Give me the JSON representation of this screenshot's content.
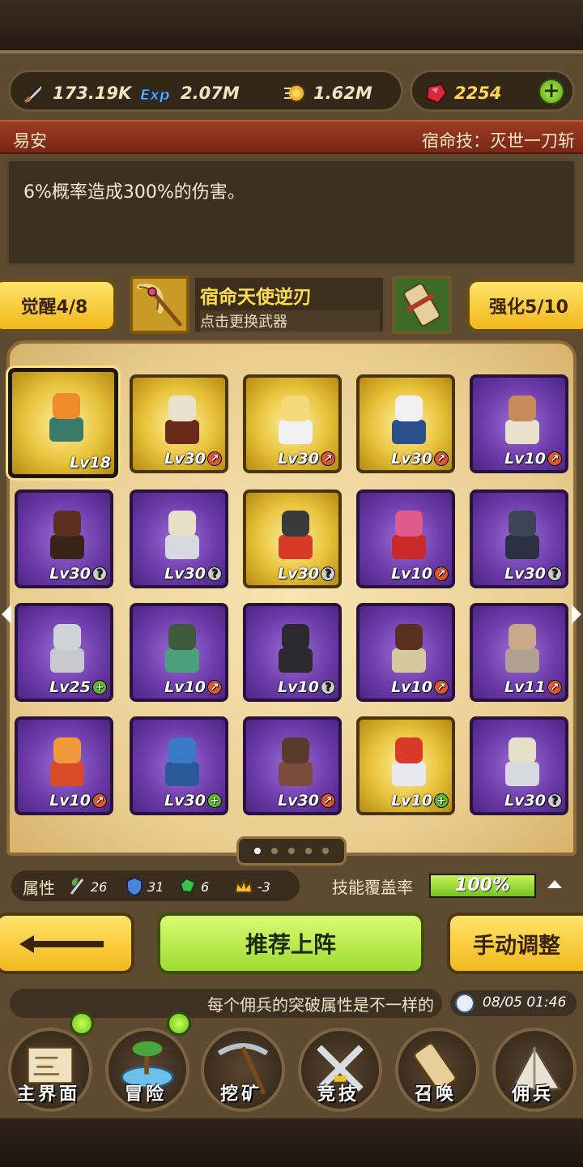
{
  "currencies": {
    "attack": "173.19K",
    "exp": "2.07M",
    "gold": "1.62M",
    "gems": "2254"
  },
  "hero": {
    "name": "易安",
    "fate_skill": "宿命技：灭世一刀斩",
    "skill_desc": "6%概率造成300%的伤害。"
  },
  "awaken": {
    "label": "觉醒4/8"
  },
  "enhance": {
    "label": "强化5/10"
  },
  "weapon": {
    "name": "宿命天使逆刃",
    "hint": "点击更换武器"
  },
  "mercenaries": [
    {
      "level": "Lv18",
      "rarity": "gold",
      "badge": "none",
      "selected": true
    },
    {
      "level": "Lv30",
      "rarity": "gold",
      "badge": "up"
    },
    {
      "level": "Lv30",
      "rarity": "gold",
      "badge": "up"
    },
    {
      "level": "Lv30",
      "rarity": "gold",
      "badge": "up"
    },
    {
      "level": "Lv10",
      "rarity": "purple",
      "badge": "up"
    },
    {
      "level": "Lv30",
      "rarity": "purple",
      "badge": "question"
    },
    {
      "level": "Lv30",
      "rarity": "purple",
      "badge": "question"
    },
    {
      "level": "Lv30",
      "rarity": "gold",
      "badge": "question"
    },
    {
      "level": "Lv10",
      "rarity": "purple",
      "badge": "up"
    },
    {
      "level": "Lv30",
      "rarity": "purple",
      "badge": "question"
    },
    {
      "level": "Lv25",
      "rarity": "purple",
      "badge": "plus"
    },
    {
      "level": "Lv10",
      "rarity": "purple",
      "badge": "up"
    },
    {
      "level": "Lv10",
      "rarity": "purple",
      "badge": "question"
    },
    {
      "level": "Lv10",
      "rarity": "purple",
      "badge": "up"
    },
    {
      "level": "Lv11",
      "rarity": "purple",
      "badge": "up"
    },
    {
      "level": "Lv10",
      "rarity": "purple",
      "badge": "up"
    },
    {
      "level": "Lv30",
      "rarity": "purple",
      "badge": "plus"
    },
    {
      "level": "Lv30",
      "rarity": "purple",
      "badge": "up"
    },
    {
      "level": "Lv10",
      "rarity": "gold",
      "badge": "plus"
    },
    {
      "level": "Lv30",
      "rarity": "purple",
      "badge": "question"
    }
  ],
  "pagination": {
    "pages": 5,
    "current": 1
  },
  "attributes": {
    "label": "属性",
    "nature": "26",
    "defense": "31",
    "gem": "6",
    "crown": "-3"
  },
  "skill_coverage": {
    "label": "技能覆盖率",
    "value": "100%",
    "fraction": 1.0
  },
  "actions": {
    "recommend": "推荐上阵",
    "manual": "手动调整"
  },
  "tip": "每个佣兵的突破属性是不一样的",
  "clock": "08/05 01:46",
  "nav": [
    {
      "label": "主界面",
      "icon": "map-icon",
      "dot": true
    },
    {
      "label": "冒险",
      "icon": "island-icon",
      "dot": true
    },
    {
      "label": "挖矿",
      "icon": "pickaxe-icon",
      "dot": false
    },
    {
      "label": "竞技",
      "icon": "crossed-swords-icon",
      "dot": false
    },
    {
      "label": "召唤",
      "icon": "scroll-icon",
      "dot": false
    },
    {
      "label": "佣兵",
      "icon": "tent-icon",
      "dot": false
    }
  ],
  "colors": {
    "gold_card": "#e8c23a",
    "purple_card": "#6b3aa8",
    "gem_text": "#ffd84a",
    "coverage_fill": "#9fdb32"
  }
}
